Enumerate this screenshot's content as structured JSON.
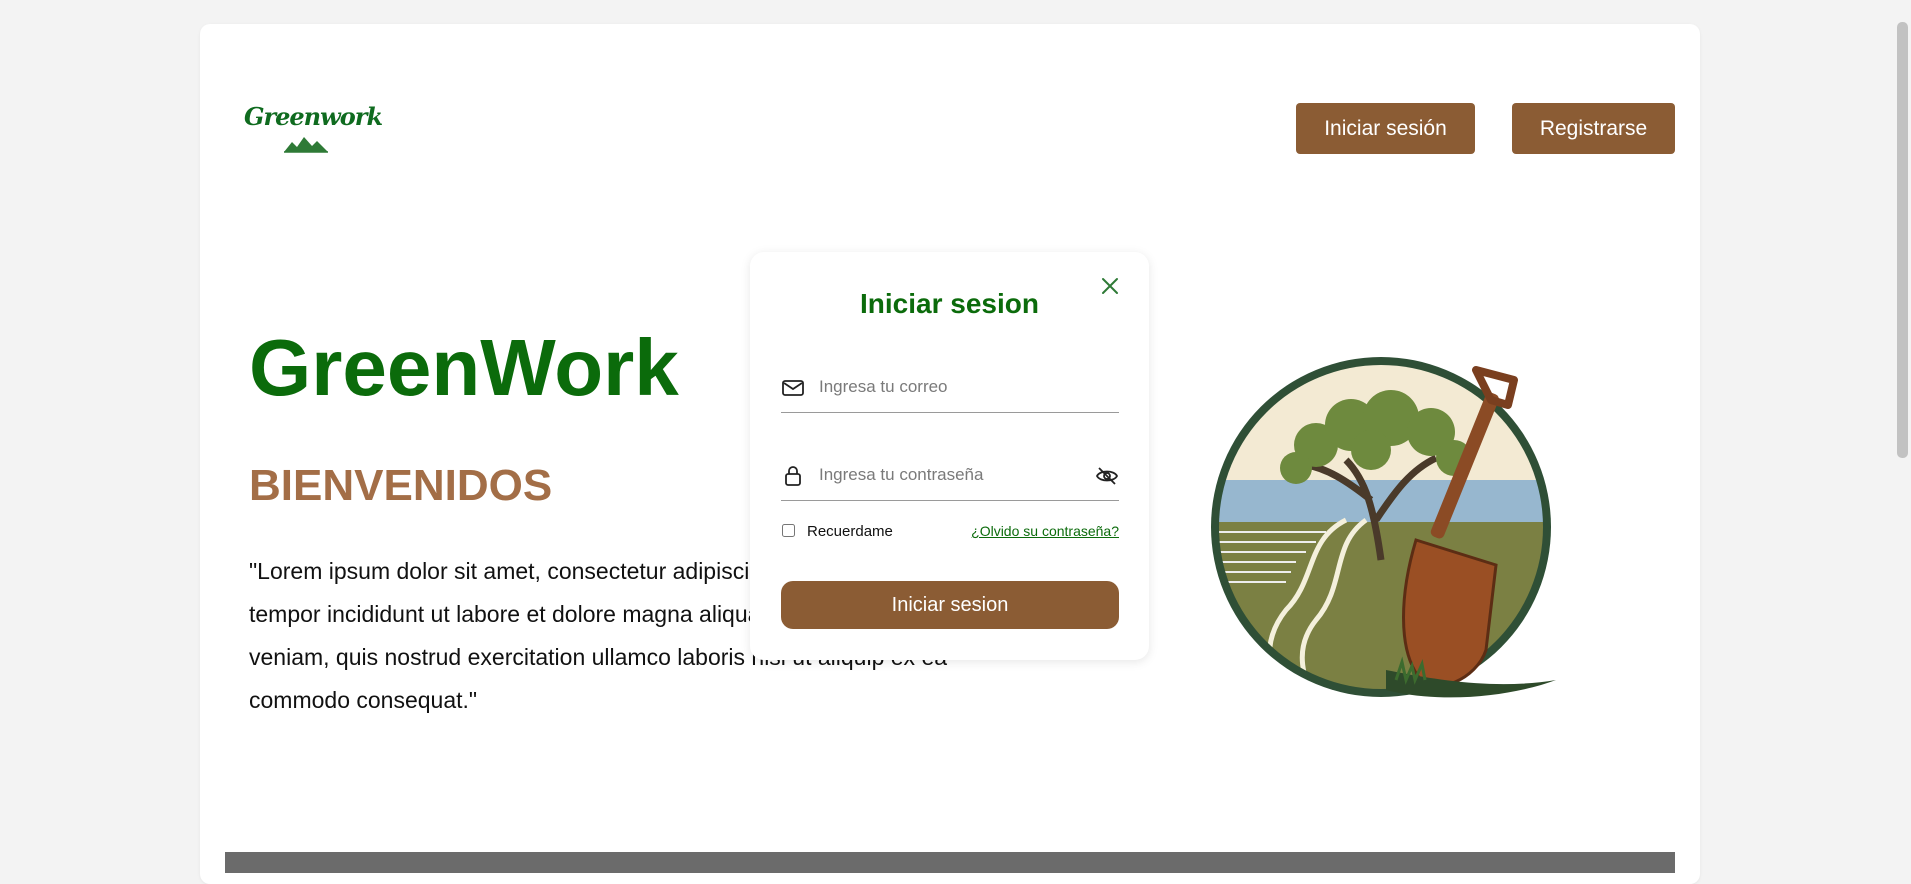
{
  "header": {
    "logo_text": "Greenwork",
    "login_label": "Iniciar sesión",
    "register_label": "Registrarse"
  },
  "hero": {
    "title": "GreenWork",
    "subtitle": "BIENVENIDOS",
    "text": "\"Lorem ipsum dolor sit amet, consectetur adipiscing elit, sed do eiusmod tempor incididunt ut labore et dolore magna aliqua. Ut enim ad minim veniam, quis nostrud exercitation ullamco laboris nisi ut aliquip ex ea commodo consequat.\""
  },
  "login_modal": {
    "title": "Iniciar sesion",
    "email_placeholder": "Ingresa tu correo",
    "password_placeholder": "Ingresa tu contraseña",
    "remember_label": "Recuerdame",
    "remember_checked": false,
    "forgot_link": "¿Olvido su contraseña?",
    "submit_label": "Iniciar sesion"
  },
  "icons": {
    "close": "close-icon",
    "email": "envelope-icon",
    "password": "lock-icon",
    "toggle_password": "eye-off-icon"
  },
  "colors": {
    "brand_green": "#0b6b0b",
    "button_brown": "#8b5c34",
    "subtitle_brown": "#a36e47",
    "footer_gray": "#6b6b6b"
  }
}
